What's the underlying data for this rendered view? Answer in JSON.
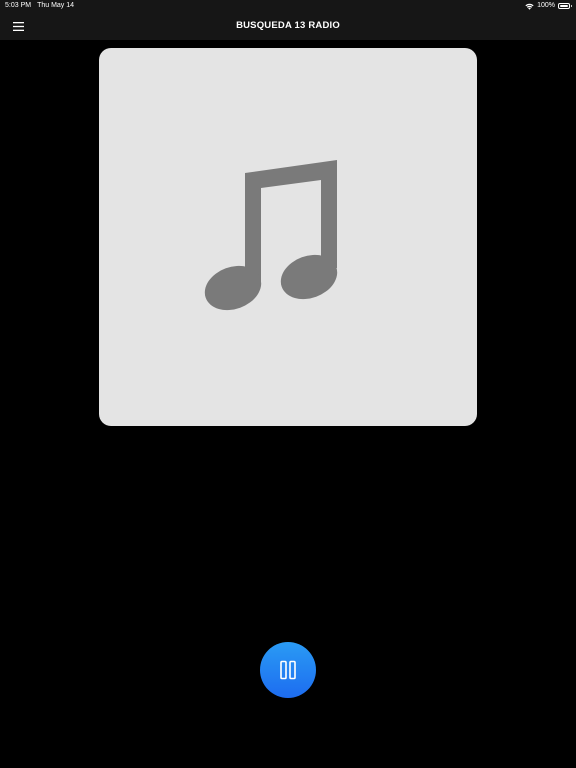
{
  "status_bar": {
    "time": "5:03 PM",
    "date": "Thu May 14",
    "battery": "100%",
    "icons": [
      "wifi-icon",
      "battery-icon"
    ]
  },
  "nav": {
    "title": "BUSQUEDA 13 RADIO",
    "menu_icon": "hamburger-menu-icon"
  },
  "player": {
    "artwork_icon": "music-note-icon",
    "artwork_background": "#e4e4e4",
    "control_icon": "pause-icon",
    "state": "playing",
    "accent_gradient": [
      "#2a9bf4",
      "#1d6cf0"
    ]
  },
  "colors": {
    "background": "#000000",
    "bar": "#161616",
    "icon_gray": "#7a7a7a"
  }
}
